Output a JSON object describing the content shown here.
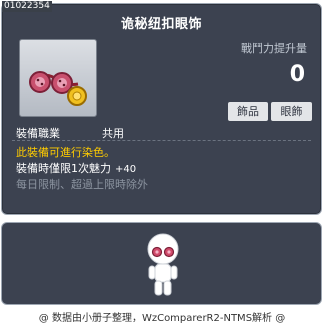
{
  "item_id": "01022354",
  "item": {
    "name": "诡秘纽扣眼饰",
    "power_label": "戰鬥力提升量",
    "power_value": "0",
    "tags": [
      "飾品",
      "眼飾"
    ],
    "job_label": "裝備職業",
    "job_value": "共用",
    "dye_text": "此裝備可進行染色。",
    "stat_text": "裝備時僅限1次魅力",
    "stat_value": "+40",
    "limit_text": "每日限制、超過上限時除外"
  },
  "colors": {
    "panel_bg": "#3c4250",
    "panel_border": "#9ea7b3",
    "dye_text": "#ffcc00",
    "muted_text": "#8c94a0"
  },
  "icons": {
    "item_icon": "button-eye-accessory-icon",
    "preview": "character-preview"
  },
  "footer": "@ 数据由小册子整理，WzComparerR2-NTMS解析 @"
}
